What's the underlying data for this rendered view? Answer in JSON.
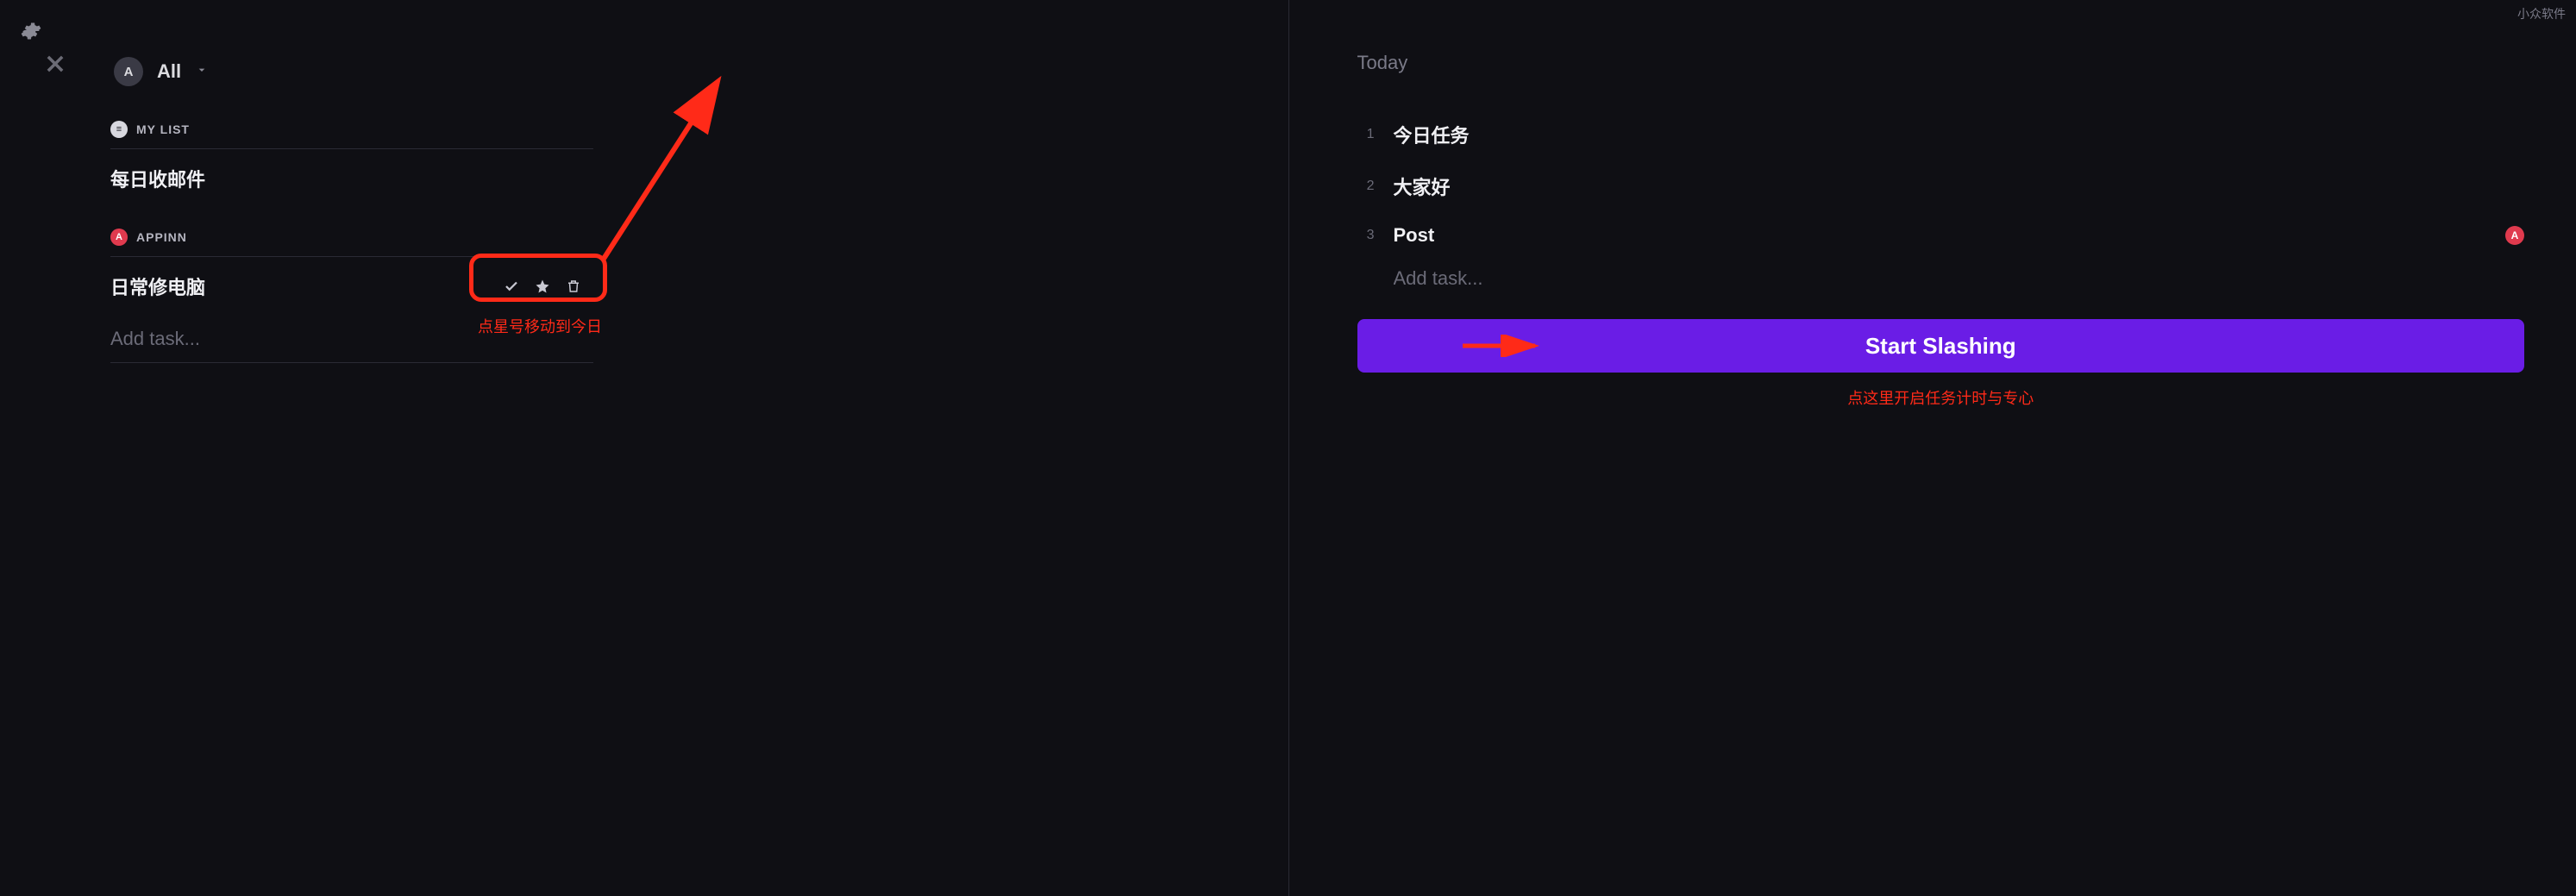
{
  "watermark": "小众软件",
  "topbar": {
    "avatar_letter": "A",
    "filter_label": "All"
  },
  "left": {
    "sections": [
      {
        "icon_letter": "≡",
        "icon_style": "gray",
        "title": "MY LIST",
        "tasks": [
          {
            "title": "每日收邮件",
            "show_actions": false
          }
        ],
        "show_add": false
      },
      {
        "icon_letter": "A",
        "icon_style": "red",
        "title": "APPINN",
        "tasks": [
          {
            "title": "日常修电脑",
            "show_actions": true
          }
        ],
        "show_add": true,
        "add_placeholder": "Add task..."
      }
    ]
  },
  "annotations": {
    "star_hint": "点星号移动到今日",
    "start_hint": "点这里开启任务计时与专心"
  },
  "right": {
    "heading": "Today",
    "items": [
      {
        "num": "1",
        "title": "今日任务",
        "badge": null
      },
      {
        "num": "2",
        "title": "大家好",
        "badge": null
      },
      {
        "num": "3",
        "title": "Post",
        "badge": "A"
      }
    ],
    "add_placeholder": "Add task...",
    "start_label": "Start Slashing"
  }
}
